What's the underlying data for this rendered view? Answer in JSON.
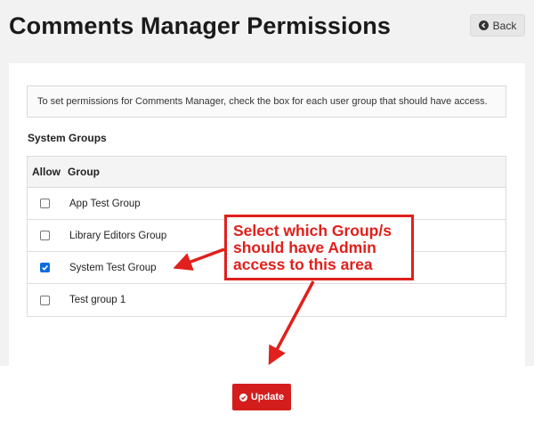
{
  "page": {
    "title": "Comments Manager Permissions",
    "back_label": "Back"
  },
  "info": {
    "text": "To set permissions for Comments Manager, check the box for each user group that should have access."
  },
  "section": {
    "heading": "System Groups"
  },
  "table": {
    "headers": {
      "allow": "Allow",
      "group": "Group"
    },
    "rows": [
      {
        "group": "App Test Group",
        "allowed": false
      },
      {
        "group": "Library Editors Group",
        "allowed": false
      },
      {
        "group": "System Test Group",
        "allowed": true
      },
      {
        "group": "Test group 1",
        "allowed": false
      }
    ]
  },
  "footer": {
    "update_label": "Update"
  },
  "annotation": {
    "lines": [
      "Select which Group/s",
      "should have Admin",
      "access to this area"
    ]
  },
  "colors": {
    "accent_red": "#d41d1d",
    "annotation_red": "#e0201c",
    "checkbox_blue": "#0b6cde",
    "background": "#f2f2f2"
  },
  "icons": {
    "back": "arrow-left-circle-icon",
    "update": "check-circle-icon",
    "checkmark": "check-icon"
  }
}
